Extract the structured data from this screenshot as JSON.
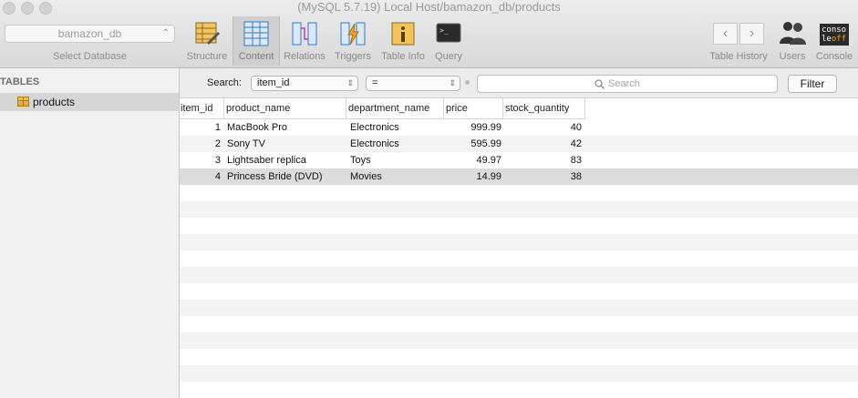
{
  "window": {
    "title": "(MySQL 5.7.19) Local Host/bamazon_db/products"
  },
  "database": {
    "selected": "bamazon_db",
    "caption": "Select Database"
  },
  "toolbar": {
    "items": [
      {
        "label": "Structure",
        "icon": "structure-icon"
      },
      {
        "label": "Content",
        "icon": "content-icon"
      },
      {
        "label": "Relations",
        "icon": "relations-icon"
      },
      {
        "label": "Triggers",
        "icon": "triggers-icon"
      },
      {
        "label": "Table Info",
        "icon": "table-info-icon"
      },
      {
        "label": "Query",
        "icon": "query-icon"
      }
    ],
    "right": [
      {
        "label": "Table History",
        "icon": "history-nav-icon"
      },
      {
        "label": "Users",
        "icon": "users-icon"
      },
      {
        "label": "Console",
        "icon": "console-icon"
      }
    ],
    "console_icon_text_1": "conso",
    "console_icon_text_2": "le",
    "console_icon_text_3": "off",
    "query_icon_text": ">_"
  },
  "sidebar": {
    "heading": "TABLES",
    "tables": [
      {
        "name": "products"
      }
    ]
  },
  "filter": {
    "search_label": "Search:",
    "field": "item_id",
    "operator": "=",
    "placeholder": "Search",
    "button": "Filter"
  },
  "grid": {
    "columns": [
      "item_id",
      "product_name",
      "department_name",
      "price",
      "stock_quantity"
    ],
    "rows": [
      [
        "1",
        "MacBook Pro",
        "Electronics",
        "999.99",
        "40"
      ],
      [
        "2",
        "Sony TV",
        "Electronics",
        "595.99",
        "42"
      ],
      [
        "3",
        "Lightsaber replica",
        "Toys",
        "49.97",
        "83"
      ],
      [
        "4",
        "Princess Bride (DVD)",
        "Movies",
        "14.99",
        "38"
      ]
    ],
    "selected_row": 4
  },
  "colors": {
    "stripe": "#f3f3f3",
    "selected": "#dcdcdc",
    "accent": "#e3a33d"
  }
}
